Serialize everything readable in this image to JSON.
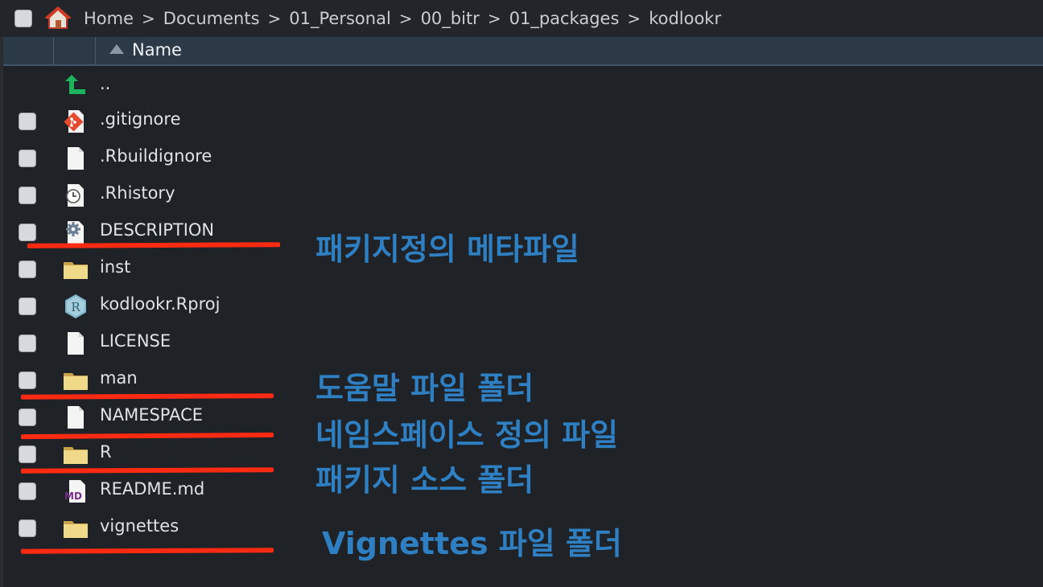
{
  "breadcrumb": {
    "items": [
      "Home",
      "Documents",
      "01_Personal",
      "00_bitr",
      "01_packages",
      "kodlookr"
    ],
    "separator": ">"
  },
  "header": {
    "name_label": "Name"
  },
  "files": [
    {
      "name": "..",
      "icon": "parent-directory-arrow-icon",
      "checkbox": false
    },
    {
      "name": ".gitignore",
      "icon": "git-file-icon",
      "checkbox": true
    },
    {
      "name": ".Rbuildignore",
      "icon": "blank-file-icon",
      "checkbox": true
    },
    {
      "name": ".Rhistory",
      "icon": "history-file-icon",
      "checkbox": true
    },
    {
      "name": "DESCRIPTION",
      "icon": "gear-file-icon",
      "checkbox": true
    },
    {
      "name": "inst",
      "icon": "folder-icon",
      "checkbox": true
    },
    {
      "name": "kodlookr.Rproj",
      "icon": "r-project-icon",
      "checkbox": true
    },
    {
      "name": "LICENSE",
      "icon": "blank-file-icon",
      "checkbox": true
    },
    {
      "name": "man",
      "icon": "folder-icon",
      "checkbox": true
    },
    {
      "name": "NAMESPACE",
      "icon": "blank-file-icon",
      "checkbox": true
    },
    {
      "name": "R",
      "icon": "folder-icon",
      "checkbox": true
    },
    {
      "name": "README.md",
      "icon": "markdown-file-icon",
      "checkbox": true
    },
    {
      "name": "vignettes",
      "icon": "folder-icon",
      "checkbox": true
    }
  ],
  "annotations": {
    "description": "패키지정의 메타파일",
    "man": "도움말 파일 폴더",
    "namespace": "네임스페이스 정의 파일",
    "r": "패키지 소스 폴더",
    "vignettes": "Vignettes 파일 폴더"
  },
  "colors": {
    "annotation_text": "#2f7fc3",
    "underline": "#ff2a12",
    "header_bg": "#2c3a48",
    "background": "#1f2226"
  }
}
